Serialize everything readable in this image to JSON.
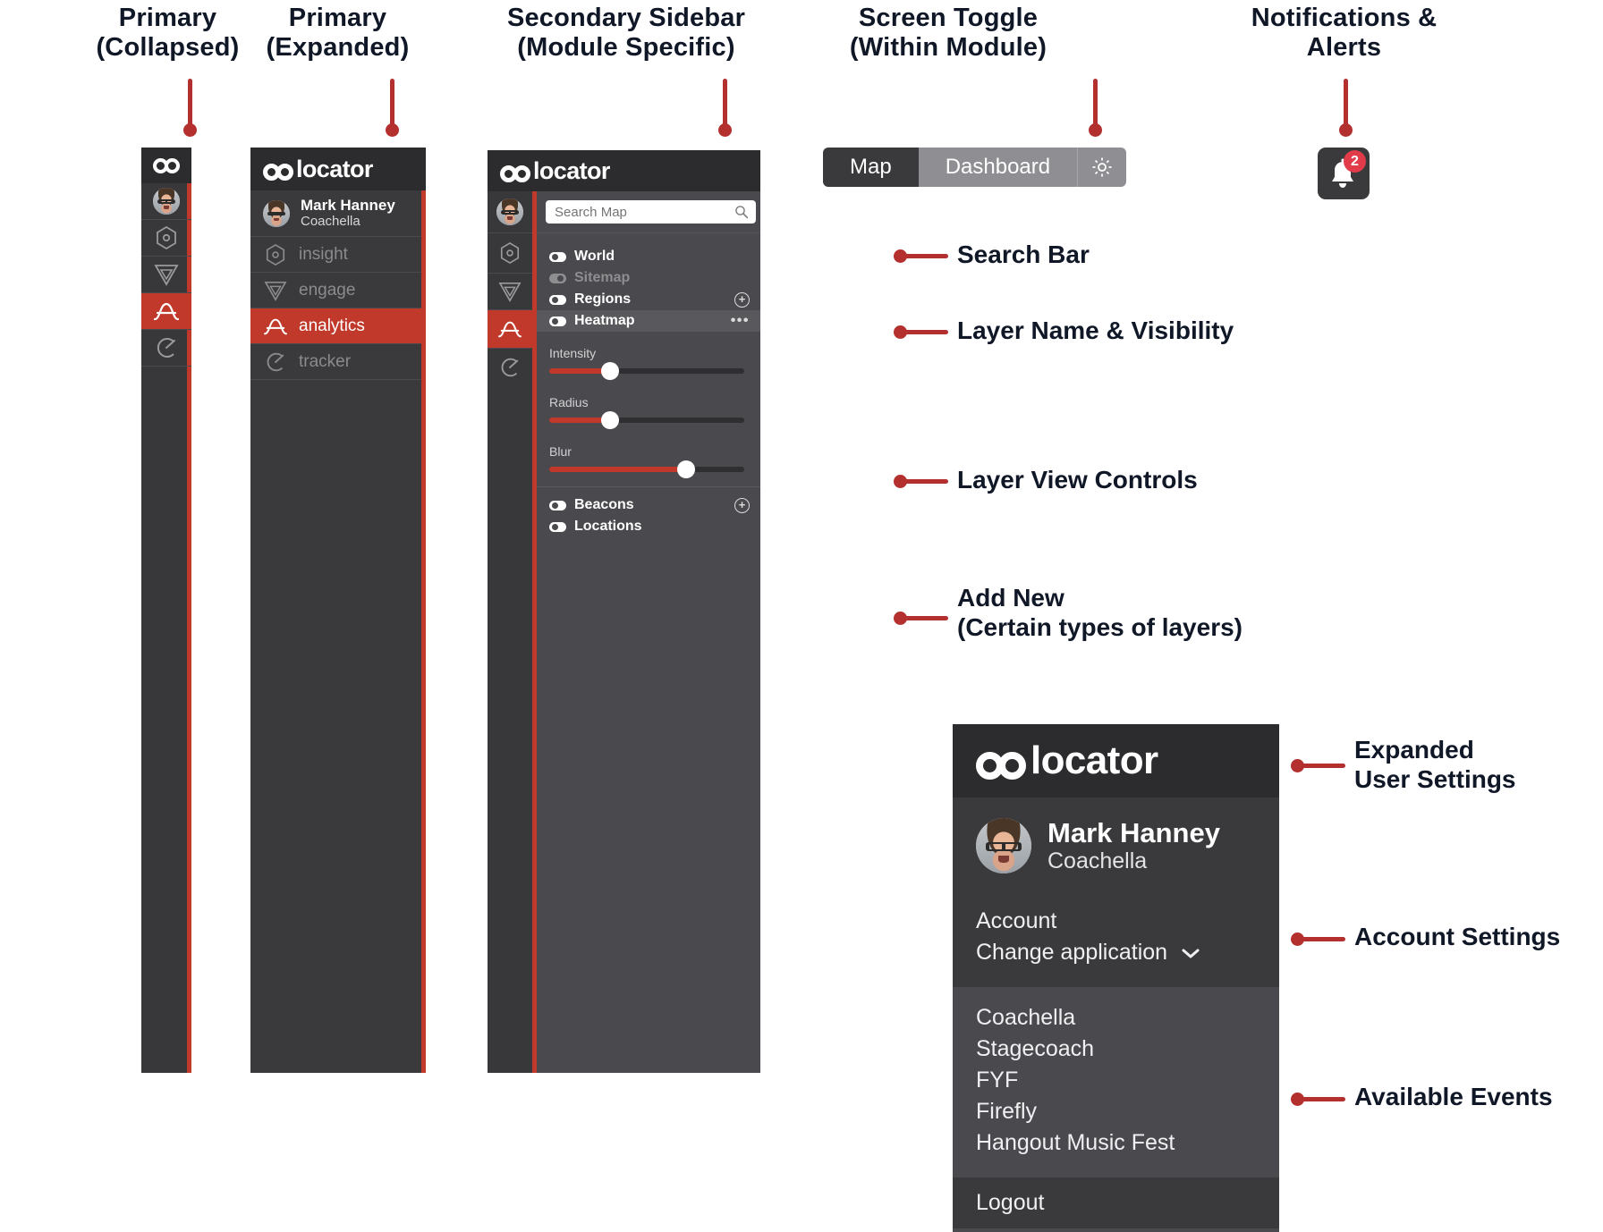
{
  "headings": [
    {
      "text": "Primary\n(Collapsed)"
    },
    {
      "text": "Primary\n(Expanded)"
    },
    {
      "text": "Secondary Sidebar\n(Module Specific)"
    },
    {
      "text": "Screen Toggle\n(Within Module)"
    },
    {
      "text": "Notifications\n& Alerts"
    }
  ],
  "callouts": [
    {
      "text": "Search Bar"
    },
    {
      "text": "Layer Name & Visibility"
    },
    {
      "text": "Layer View Controls"
    },
    {
      "text": "Add New\n(Certain types of layers)"
    },
    {
      "text": "Expanded\nUser Settings"
    },
    {
      "text": "Account Settings"
    },
    {
      "text": "Available Events"
    }
  ],
  "brand": {
    "name": "locator",
    "full": "colocator"
  },
  "primary": {
    "user": {
      "name": "Mark Hanney",
      "org": "Coachella"
    },
    "items": [
      {
        "label": "insight",
        "icon": "hexagon-icon",
        "active": false
      },
      {
        "label": "engage",
        "icon": "triangle-down-icon",
        "active": false
      },
      {
        "label": "analytics",
        "icon": "analytics-curve-icon",
        "active": true
      },
      {
        "label": "tracker",
        "icon": "tracker-circle-icon",
        "active": false
      }
    ]
  },
  "secondary": {
    "search": {
      "value": "",
      "placeholder": "Search Map",
      "icon": "search-icon"
    },
    "layers": [
      {
        "label": "World",
        "visible": true,
        "dim": false,
        "action": "",
        "selected": false
      },
      {
        "label": "Sitemap",
        "visible": false,
        "dim": true,
        "action": "",
        "selected": false
      },
      {
        "label": "Regions",
        "visible": true,
        "dim": false,
        "action": "plus",
        "selected": false
      },
      {
        "label": "Heatmap",
        "visible": true,
        "dim": false,
        "action": "dots",
        "selected": true
      }
    ],
    "controls": [
      {
        "label": "Intensity",
        "value": 31
      },
      {
        "label": "Radius",
        "value": 31
      },
      {
        "label": "Blur",
        "value": 70
      }
    ],
    "layers_bottom": [
      {
        "label": "Beacons",
        "visible": true,
        "dim": false,
        "action": "plus",
        "selected": false
      },
      {
        "label": "Locations",
        "visible": true,
        "dim": false,
        "action": "",
        "selected": false
      }
    ]
  },
  "screen_toggle": {
    "options": [
      {
        "label": "Map",
        "active": true
      },
      {
        "label": "Dashboard",
        "active": false
      }
    ],
    "settings_icon": "gear-icon"
  },
  "notifications": {
    "count": "2",
    "icon": "bell-icon"
  },
  "user_settings": {
    "user": {
      "name": "Mark Hanney",
      "org": "Coachella"
    },
    "account_label": "Account",
    "change_app_label": "Change application",
    "chevron_icon": "chevron-down-icon",
    "events": [
      "Coachella",
      "Stagecoach",
      "FYF",
      "Firefly",
      "Hangout Music Fest"
    ],
    "logout_label": "Logout"
  },
  "colors": {
    "accent": "#c0392b",
    "panel": "#3a3a3c",
    "panel_light": "#4a4a4e",
    "badge": "#e23b4a",
    "text_dark": "#101828"
  }
}
